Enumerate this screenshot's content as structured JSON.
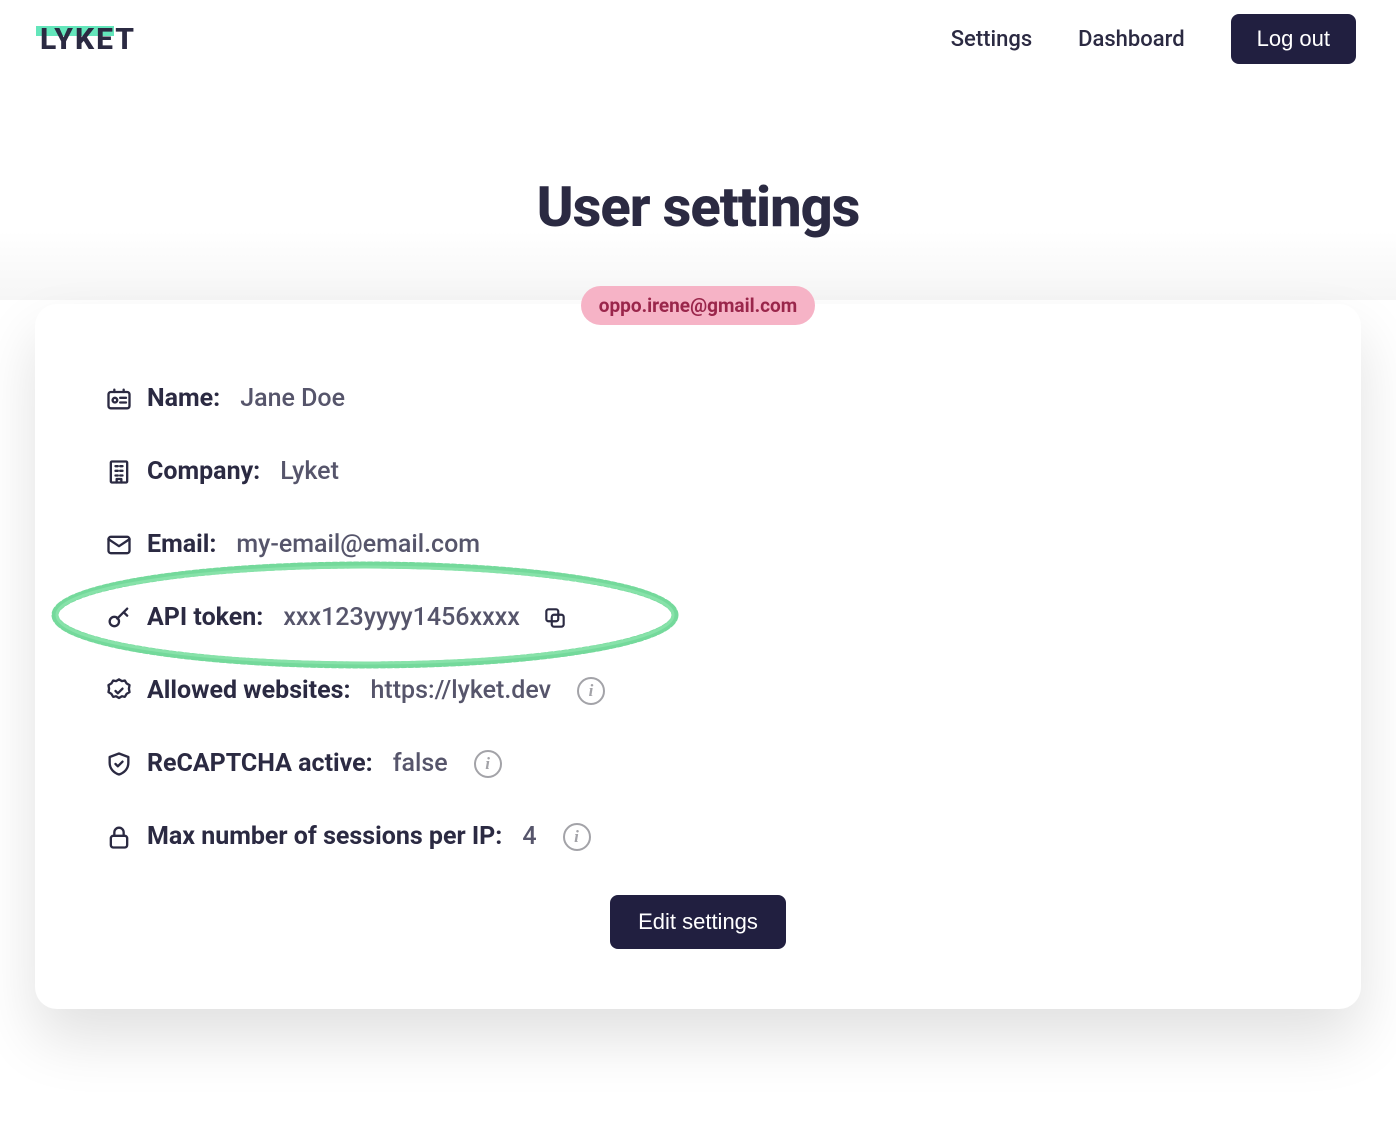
{
  "logo": "LYKET",
  "nav": {
    "settings": "Settings",
    "dashboard": "Dashboard",
    "logout": "Log out"
  },
  "page_title": "User settings",
  "email_badge": "oppo.irene@gmail.com",
  "fields": {
    "name": {
      "label": "Name:",
      "value": "Jane Doe"
    },
    "company": {
      "label": "Company:",
      "value": "Lyket"
    },
    "email": {
      "label": "Email:",
      "value": "my-email@email.com"
    },
    "api_token": {
      "label": "API token:",
      "value": "xxx123yyyy1456xxxx"
    },
    "allowed_websites": {
      "label": "Allowed websites:",
      "value": "https://lyket.dev"
    },
    "recaptcha": {
      "label": "ReCAPTCHA active:",
      "value": "false"
    },
    "max_sessions": {
      "label": "Max number of sessions per IP:",
      "value": "4"
    }
  },
  "edit_button": "Edit settings"
}
